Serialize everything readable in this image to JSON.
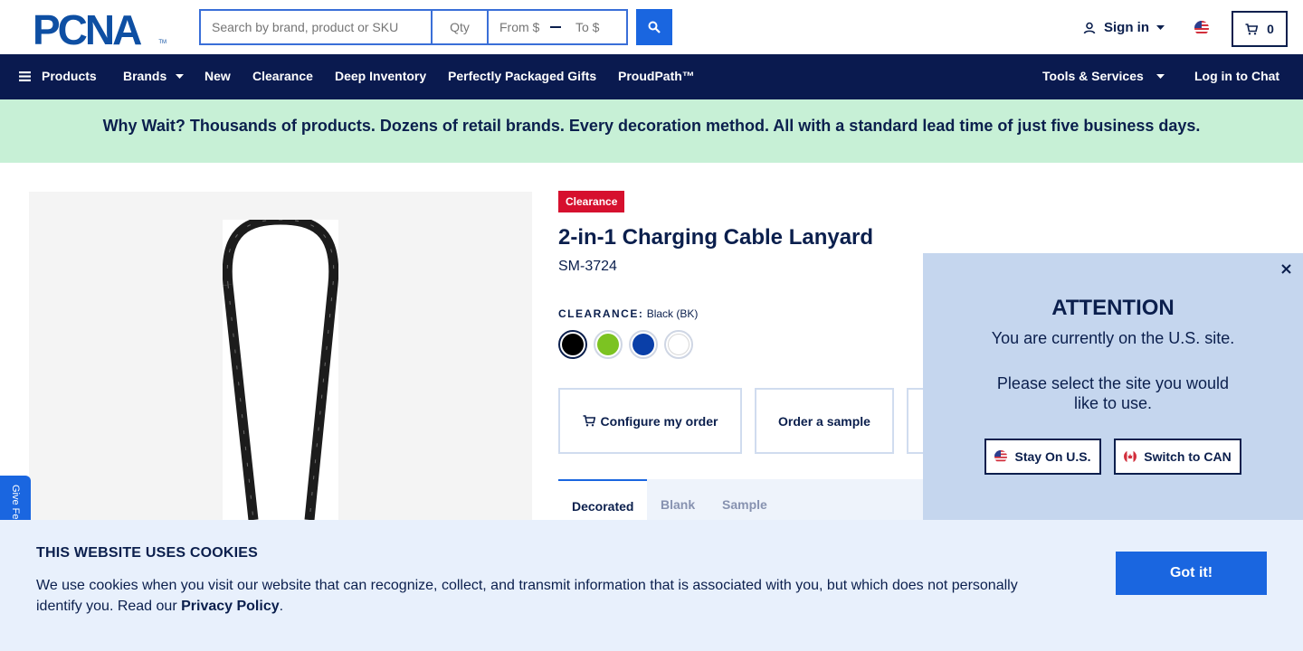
{
  "header": {
    "logo_text": "PCNA",
    "logo_tm": "TM",
    "search_placeholder": "Search by brand, product or SKU",
    "qty_placeholder": "Qty",
    "price_from_placeholder": "From $",
    "price_to_placeholder": "To $",
    "signin_label": "Sign in",
    "cart_count": "0"
  },
  "nav": {
    "products": "Products",
    "brands": "Brands",
    "new": "New",
    "clearance": "Clearance",
    "deep_inventory": "Deep Inventory",
    "gifts": "Perfectly Packaged Gifts",
    "proudpath": "ProudPath™",
    "tools": "Tools & Services",
    "chat": "Log in to Chat"
  },
  "banner": {
    "text": "Why Wait? Thousands of products. Dozens of retail brands. Every decoration method. All with a standard lead time of just five business days."
  },
  "feedback_tab": "Give Feedback",
  "product": {
    "badge": "Clearance",
    "title": "2-in-1 Charging Cable Lanyard",
    "sku": "SM-3724",
    "color_label": "CLEARANCE:",
    "color_value": "Black (BK)",
    "swatches": [
      {
        "name": "Black",
        "color": "#000000"
      },
      {
        "name": "Lime",
        "color": "#7cc322"
      },
      {
        "name": "Blue",
        "color": "#0a3fa8"
      },
      {
        "name": "White",
        "color": "#ffffff"
      }
    ],
    "actions": {
      "configure": "Configure my order",
      "sample": "Order a sample"
    },
    "tabs": [
      "Decorated",
      "Blank",
      "Sample"
    ]
  },
  "region_modal": {
    "title": "ATTENTION",
    "line1": "You are currently on the U.S. site.",
    "line2": "Please select the site you would like to use.",
    "stay_label": "Stay On U.S.",
    "switch_label": "Switch to CAN"
  },
  "cookie": {
    "title": "THIS WEBSITE USES COOKIES",
    "text": "We use cookies when you visit our website that can recognize, collect, and transmit information that is associated with you, but which does not personally identify you. Read our ",
    "link": "Privacy Policy",
    "end": ".",
    "button": "Got it!"
  },
  "colors": {
    "navy": "#0a1a4f",
    "accent_blue": "#1a66e0",
    "banner_green": "#c7f0d6",
    "clearance_red": "#d6102e",
    "modal_bg": "#c5d6ee",
    "cookie_bg": "#e8f0fc"
  }
}
